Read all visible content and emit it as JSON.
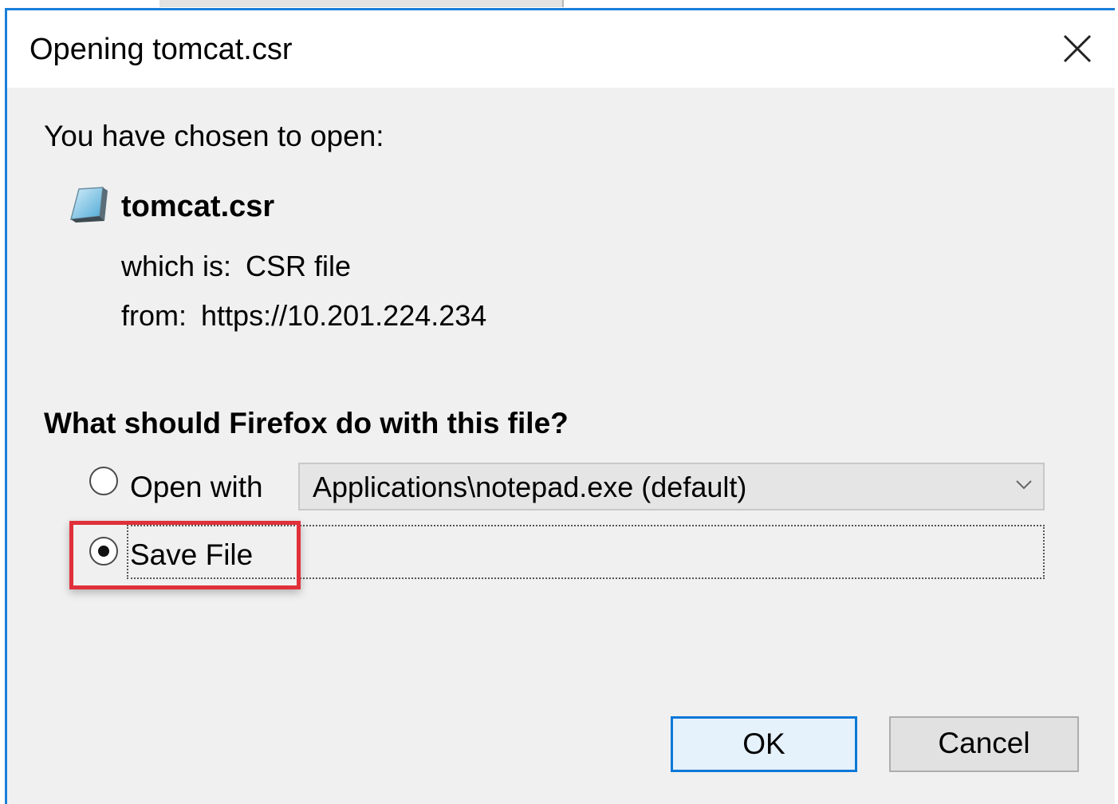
{
  "dialog": {
    "title": "Opening tomcat.csr",
    "intro": "You have chosen to open:",
    "file_name": "tomcat.csr",
    "which_label": "which is:",
    "which_value": "CSR file",
    "from_label": "from:",
    "from_value": "https://10.201.224.234",
    "question": "What should Firefox do with this file?",
    "options": {
      "open_with_label": "Open with",
      "open_with_selected": false,
      "application_select_value": "Applications\\notepad.exe (default)",
      "save_file_label": "Save File",
      "save_file_selected": true
    },
    "buttons": {
      "ok_label": "OK",
      "cancel_label": "Cancel"
    }
  },
  "icons": {
    "close": "close-icon",
    "file": "file-icon",
    "dropdown": "chevron-down-icon"
  },
  "colors": {
    "window_border": "#1a7fd9",
    "highlight": "#e0303a",
    "default_button_border": "#0a78d7"
  }
}
